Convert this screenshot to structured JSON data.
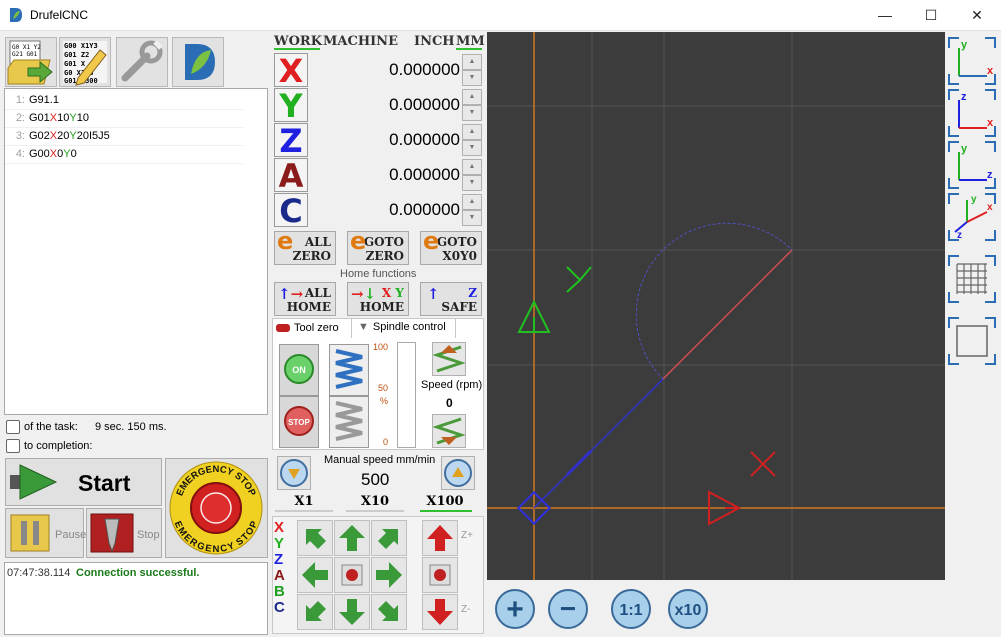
{
  "window": {
    "title": "DrufelCNC",
    "controls": [
      "—",
      "☐",
      "✕"
    ]
  },
  "toolbar": {
    "icons": [
      "open-gcode-icon",
      "edit-gcode-icon",
      "settings-wrench-icon",
      "drufel-logo-icon"
    ]
  },
  "gcode": {
    "lines": [
      {
        "num": "1:",
        "text": "G91.1"
      },
      {
        "num": "2:",
        "text": "G01X10Y10"
      },
      {
        "num": "3:",
        "text": "G02X20Y20I5J5"
      },
      {
        "num": "4:",
        "text": "G00X0Y0"
      }
    ]
  },
  "task": {
    "time_label": "of the task:",
    "time_value": "9 sec. 150 ms.",
    "completion_label": "to completion:"
  },
  "controls": {
    "start": "Start",
    "pause": "Pause",
    "stop": "Stop",
    "emergency_top": "EMERGENCY STOP",
    "emergency_bottom": "EMERGENCY STOP"
  },
  "log": {
    "time": "07:47:38.114",
    "message": "Connection successful."
  },
  "dro": {
    "work": "WORK",
    "machine": "MACHINE",
    "inch": "INCH",
    "mm": "MM",
    "axes": [
      {
        "letter": "X",
        "value": "0.000000",
        "color": "#e02020"
      },
      {
        "letter": "Y",
        "value": "0.000000",
        "color": "#20b020"
      },
      {
        "letter": "Z",
        "value": "0.000000",
        "color": "#2020e0"
      },
      {
        "letter": "A",
        "value": "0.000000",
        "color": "#8b1a1a"
      },
      {
        "letter": "C",
        "value": "0.000000",
        "color": "#1a2a8b"
      }
    ]
  },
  "functions": {
    "all_zero": [
      "ALL",
      "ZERO"
    ],
    "goto_zero": [
      "GOTO",
      "ZERO"
    ],
    "goto_x0y0": [
      "GOTO",
      "X0Y0"
    ],
    "home_label": "Home functions",
    "all_home": [
      "ALL",
      "HOME"
    ],
    "xy_home": [
      "X Y",
      "HOME"
    ],
    "z_safe": [
      "Z",
      "SAFE"
    ]
  },
  "tabs": {
    "tool_zero": "Tool zero",
    "spindle": "Spindle control"
  },
  "spindle": {
    "on": "ON",
    "stop": "STOP",
    "scale": [
      "100",
      "50",
      "%",
      "0"
    ],
    "speed_label": "Speed (rpm)",
    "speed_value": "0"
  },
  "manual": {
    "label": "Manual speed mm/min",
    "value": "500",
    "mult": [
      "X1",
      "X10",
      "X100"
    ],
    "active_mult": "X100"
  },
  "jog": {
    "axes": [
      "X",
      "Y",
      "Z",
      "A",
      "B",
      "C"
    ],
    "z_plus": "Z+",
    "z_minus": "Z-"
  },
  "views": {
    "xy": [
      "y",
      "x"
    ],
    "zx": [
      "z",
      "x"
    ],
    "yz": [
      "y",
      "z"
    ],
    "xyz": [
      "z",
      "y",
      "x"
    ]
  },
  "zoom": {
    "in": "+",
    "out": "−",
    "one": "1:1",
    "ten": "x10"
  },
  "colors": {
    "x": "#e02020",
    "y": "#20b020",
    "z": "#2020e0",
    "canvas_bg": "#3c3c3c",
    "accent": "#1e6fb0"
  }
}
